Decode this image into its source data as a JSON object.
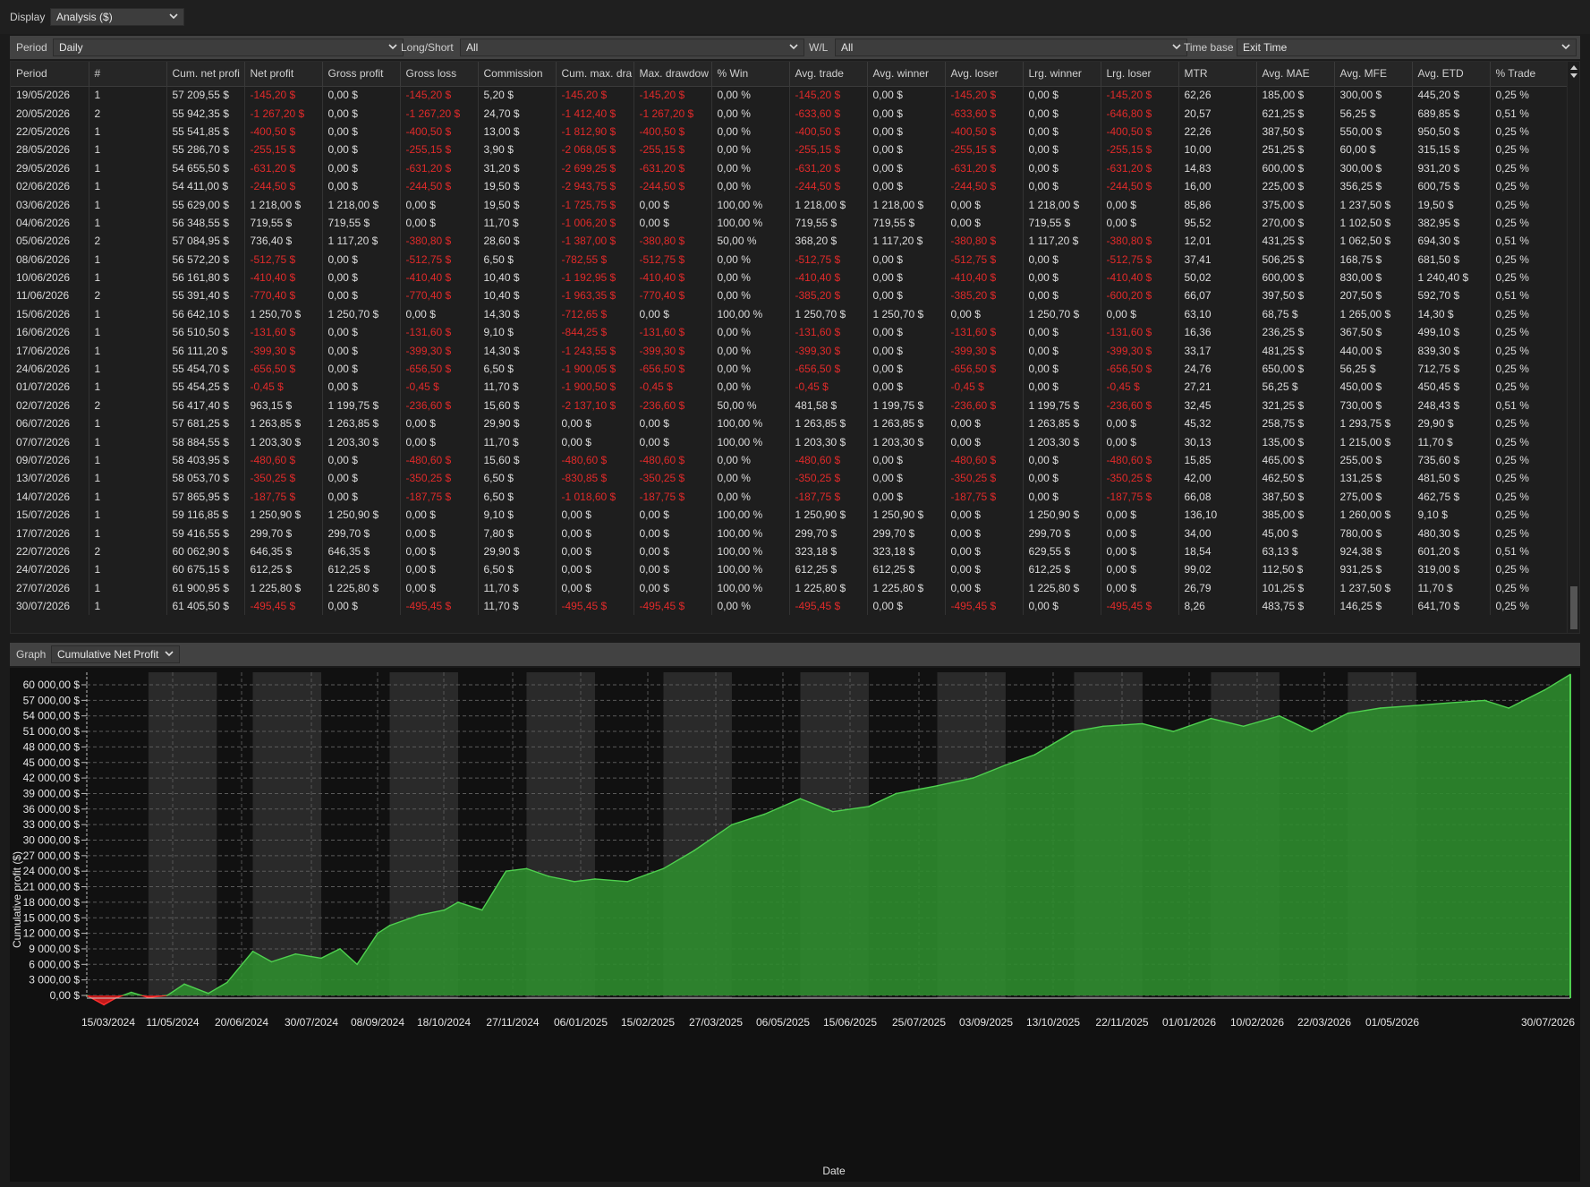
{
  "display": {
    "label": "Display",
    "value": "Analysis ($)"
  },
  "filters": {
    "period_label": "Period",
    "period_value": "Daily",
    "longshort_label": "Long/Short",
    "longshort_value": "All",
    "wl_label": "W/L",
    "wl_value": "All",
    "timebase_label": "Time base",
    "timebase_value": "Exit Time"
  },
  "table": {
    "columns": [
      "Period",
      "#",
      "Cum. net profi",
      "Net profit",
      "Gross profit",
      "Gross loss",
      "Commission",
      "Cum. max. dra",
      "Max. drawdow",
      "% Win",
      "Avg. trade",
      "Avg. winner",
      "Avg. loser",
      "Lrg. winner",
      "Lrg. loser",
      "MTR",
      "Avg. MAE",
      "Avg. MFE",
      "Avg. ETD",
      "% Trade"
    ],
    "rows": [
      [
        "19/05/2026",
        "1",
        "57 209,55 $",
        "-145,20 $",
        "0,00 $",
        "-145,20 $",
        "5,20 $",
        "-145,20 $",
        "-145,20 $",
        "0,00 %",
        "-145,20 $",
        "0,00 $",
        "-145,20 $",
        "0,00 $",
        "-145,20 $",
        "62,26",
        "185,00 $",
        "300,00 $",
        "445,20 $",
        "0,25 %"
      ],
      [
        "20/05/2026",
        "2",
        "55 942,35 $",
        "-1 267,20 $",
        "0,00 $",
        "-1 267,20 $",
        "24,70 $",
        "-1 412,40 $",
        "-1 267,20 $",
        "0,00 %",
        "-633,60 $",
        "0,00 $",
        "-633,60 $",
        "0,00 $",
        "-646,80 $",
        "20,57",
        "621,25 $",
        "56,25 $",
        "689,85 $",
        "0,51 %"
      ],
      [
        "22/05/2026",
        "1",
        "55 541,85 $",
        "-400,50 $",
        "0,00 $",
        "-400,50 $",
        "13,00 $",
        "-1 812,90 $",
        "-400,50 $",
        "0,00 %",
        "-400,50 $",
        "0,00 $",
        "-400,50 $",
        "0,00 $",
        "-400,50 $",
        "22,26",
        "387,50 $",
        "550,00 $",
        "950,50 $",
        "0,25 %"
      ],
      [
        "28/05/2026",
        "1",
        "55 286,70 $",
        "-255,15 $",
        "0,00 $",
        "-255,15 $",
        "3,90 $",
        "-2 068,05 $",
        "-255,15 $",
        "0,00 %",
        "-255,15 $",
        "0,00 $",
        "-255,15 $",
        "0,00 $",
        "-255,15 $",
        "10,00",
        "251,25 $",
        "60,00 $",
        "315,15 $",
        "0,25 %"
      ],
      [
        "29/05/2026",
        "1",
        "54 655,50 $",
        "-631,20 $",
        "0,00 $",
        "-631,20 $",
        "31,20 $",
        "-2 699,25 $",
        "-631,20 $",
        "0,00 %",
        "-631,20 $",
        "0,00 $",
        "-631,20 $",
        "0,00 $",
        "-631,20 $",
        "14,83",
        "600,00 $",
        "300,00 $",
        "931,20 $",
        "0,25 %"
      ],
      [
        "02/06/2026",
        "1",
        "54 411,00 $",
        "-244,50 $",
        "0,00 $",
        "-244,50 $",
        "19,50 $",
        "-2 943,75 $",
        "-244,50 $",
        "0,00 %",
        "-244,50 $",
        "0,00 $",
        "-244,50 $",
        "0,00 $",
        "-244,50 $",
        "16,00",
        "225,00 $",
        "356,25 $",
        "600,75 $",
        "0,25 %"
      ],
      [
        "03/06/2026",
        "1",
        "55 629,00 $",
        "1 218,00 $",
        "1 218,00 $",
        "0,00 $",
        "19,50 $",
        "-1 725,75 $",
        "0,00 $",
        "100,00 %",
        "1 218,00 $",
        "1 218,00 $",
        "0,00 $",
        "1 218,00 $",
        "0,00 $",
        "85,86",
        "375,00 $",
        "1 237,50 $",
        "19,50 $",
        "0,25 %"
      ],
      [
        "04/06/2026",
        "1",
        "56 348,55 $",
        "719,55 $",
        "719,55 $",
        "0,00 $",
        "11,70 $",
        "-1 006,20 $",
        "0,00 $",
        "100,00 %",
        "719,55 $",
        "719,55 $",
        "0,00 $",
        "719,55 $",
        "0,00 $",
        "95,52",
        "270,00 $",
        "1 102,50 $",
        "382,95 $",
        "0,25 %"
      ],
      [
        "05/06/2026",
        "2",
        "57 084,95 $",
        "736,40 $",
        "1 117,20 $",
        "-380,80 $",
        "28,60 $",
        "-1 387,00 $",
        "-380,80 $",
        "50,00 %",
        "368,20 $",
        "1 117,20 $",
        "-380,80 $",
        "1 117,20 $",
        "-380,80 $",
        "12,01",
        "431,25 $",
        "1 062,50 $",
        "694,30 $",
        "0,51 %"
      ],
      [
        "08/06/2026",
        "1",
        "56 572,20 $",
        "-512,75 $",
        "0,00 $",
        "-512,75 $",
        "6,50 $",
        "-782,55 $",
        "-512,75 $",
        "0,00 %",
        "-512,75 $",
        "0,00 $",
        "-512,75 $",
        "0,00 $",
        "-512,75 $",
        "37,41",
        "506,25 $",
        "168,75 $",
        "681,50 $",
        "0,25 %"
      ],
      [
        "10/06/2026",
        "1",
        "56 161,80 $",
        "-410,40 $",
        "0,00 $",
        "-410,40 $",
        "10,40 $",
        "-1 192,95 $",
        "-410,40 $",
        "0,00 %",
        "-410,40 $",
        "0,00 $",
        "-410,40 $",
        "0,00 $",
        "-410,40 $",
        "50,02",
        "600,00 $",
        "830,00 $",
        "1 240,40 $",
        "0,25 %"
      ],
      [
        "11/06/2026",
        "2",
        "55 391,40 $",
        "-770,40 $",
        "0,00 $",
        "-770,40 $",
        "10,40 $",
        "-1 963,35 $",
        "-770,40 $",
        "0,00 %",
        "-385,20 $",
        "0,00 $",
        "-385,20 $",
        "0,00 $",
        "-600,20 $",
        "66,07",
        "397,50 $",
        "207,50 $",
        "592,70 $",
        "0,51 %"
      ],
      [
        "15/06/2026",
        "1",
        "56 642,10 $",
        "1 250,70 $",
        "1 250,70 $",
        "0,00 $",
        "14,30 $",
        "-712,65 $",
        "0,00 $",
        "100,00 %",
        "1 250,70 $",
        "1 250,70 $",
        "0,00 $",
        "1 250,70 $",
        "0,00 $",
        "63,10",
        "68,75 $",
        "1 265,00 $",
        "14,30 $",
        "0,25 %"
      ],
      [
        "16/06/2026",
        "1",
        "56 510,50 $",
        "-131,60 $",
        "0,00 $",
        "-131,60 $",
        "9,10 $",
        "-844,25 $",
        "-131,60 $",
        "0,00 %",
        "-131,60 $",
        "0,00 $",
        "-131,60 $",
        "0,00 $",
        "-131,60 $",
        "16,36",
        "236,25 $",
        "367,50 $",
        "499,10 $",
        "0,25 %"
      ],
      [
        "17/06/2026",
        "1",
        "56 111,20 $",
        "-399,30 $",
        "0,00 $",
        "-399,30 $",
        "14,30 $",
        "-1 243,55 $",
        "-399,30 $",
        "0,00 %",
        "-399,30 $",
        "0,00 $",
        "-399,30 $",
        "0,00 $",
        "-399,30 $",
        "33,17",
        "481,25 $",
        "440,00 $",
        "839,30 $",
        "0,25 %"
      ],
      [
        "24/06/2026",
        "1",
        "55 454,70 $",
        "-656,50 $",
        "0,00 $",
        "-656,50 $",
        "6,50 $",
        "-1 900,05 $",
        "-656,50 $",
        "0,00 %",
        "-656,50 $",
        "0,00 $",
        "-656,50 $",
        "0,00 $",
        "-656,50 $",
        "24,76",
        "650,00 $",
        "56,25 $",
        "712,75 $",
        "0,25 %"
      ],
      [
        "01/07/2026",
        "1",
        "55 454,25 $",
        "-0,45 $",
        "0,00 $",
        "-0,45 $",
        "11,70 $",
        "-1 900,50 $",
        "-0,45 $",
        "0,00 %",
        "-0,45 $",
        "0,00 $",
        "-0,45 $",
        "0,00 $",
        "-0,45 $",
        "27,21",
        "56,25 $",
        "450,00 $",
        "450,45 $",
        "0,25 %"
      ],
      [
        "02/07/2026",
        "2",
        "56 417,40 $",
        "963,15 $",
        "1 199,75 $",
        "-236,60 $",
        "15,60 $",
        "-2 137,10 $",
        "-236,60 $",
        "50,00 %",
        "481,58 $",
        "1 199,75 $",
        "-236,60 $",
        "1 199,75 $",
        "-236,60 $",
        "32,45",
        "321,25 $",
        "730,00 $",
        "248,43 $",
        "0,51 %"
      ],
      [
        "06/07/2026",
        "1",
        "57 681,25 $",
        "1 263,85 $",
        "1 263,85 $",
        "0,00 $",
        "29,90 $",
        "0,00 $",
        "0,00 $",
        "100,00 %",
        "1 263,85 $",
        "1 263,85 $",
        "0,00 $",
        "1 263,85 $",
        "0,00 $",
        "45,32",
        "258,75 $",
        "1 293,75 $",
        "29,90 $",
        "0,25 %"
      ],
      [
        "07/07/2026",
        "1",
        "58 884,55 $",
        "1 203,30 $",
        "1 203,30 $",
        "0,00 $",
        "11,70 $",
        "0,00 $",
        "0,00 $",
        "100,00 %",
        "1 203,30 $",
        "1 203,30 $",
        "0,00 $",
        "1 203,30 $",
        "0,00 $",
        "30,13",
        "135,00 $",
        "1 215,00 $",
        "11,70 $",
        "0,25 %"
      ],
      [
        "09/07/2026",
        "1",
        "58 403,95 $",
        "-480,60 $",
        "0,00 $",
        "-480,60 $",
        "15,60 $",
        "-480,60 $",
        "-480,60 $",
        "0,00 %",
        "-480,60 $",
        "0,00 $",
        "-480,60 $",
        "0,00 $",
        "-480,60 $",
        "15,85",
        "465,00 $",
        "255,00 $",
        "735,60 $",
        "0,25 %"
      ],
      [
        "13/07/2026",
        "1",
        "58 053,70 $",
        "-350,25 $",
        "0,00 $",
        "-350,25 $",
        "6,50 $",
        "-830,85 $",
        "-350,25 $",
        "0,00 %",
        "-350,25 $",
        "0,00 $",
        "-350,25 $",
        "0,00 $",
        "-350,25 $",
        "42,00",
        "462,50 $",
        "131,25 $",
        "481,50 $",
        "0,25 %"
      ],
      [
        "14/07/2026",
        "1",
        "57 865,95 $",
        "-187,75 $",
        "0,00 $",
        "-187,75 $",
        "6,50 $",
        "-1 018,60 $",
        "-187,75 $",
        "0,00 %",
        "-187,75 $",
        "0,00 $",
        "-187,75 $",
        "0,00 $",
        "-187,75 $",
        "66,08",
        "387,50 $",
        "275,00 $",
        "462,75 $",
        "0,25 %"
      ],
      [
        "15/07/2026",
        "1",
        "59 116,85 $",
        "1 250,90 $",
        "1 250,90 $",
        "0,00 $",
        "9,10 $",
        "0,00 $",
        "0,00 $",
        "100,00 %",
        "1 250,90 $",
        "1 250,90 $",
        "0,00 $",
        "1 250,90 $",
        "0,00 $",
        "136,10",
        "385,00 $",
        "1 260,00 $",
        "9,10 $",
        "0,25 %"
      ],
      [
        "17/07/2026",
        "1",
        "59 416,55 $",
        "299,70 $",
        "299,70 $",
        "0,00 $",
        "7,80 $",
        "0,00 $",
        "0,00 $",
        "100,00 %",
        "299,70 $",
        "299,70 $",
        "0,00 $",
        "299,70 $",
        "0,00 $",
        "34,00",
        "45,00 $",
        "780,00 $",
        "480,30 $",
        "0,25 %"
      ],
      [
        "22/07/2026",
        "2",
        "60 062,90 $",
        "646,35 $",
        "646,35 $",
        "0,00 $",
        "29,90 $",
        "0,00 $",
        "0,00 $",
        "100,00 %",
        "323,18 $",
        "323,18 $",
        "0,00 $",
        "629,55 $",
        "0,00 $",
        "18,54",
        "63,13 $",
        "924,38 $",
        "601,20 $",
        "0,51 %"
      ],
      [
        "24/07/2026",
        "1",
        "60 675,15 $",
        "612,25 $",
        "612,25 $",
        "0,00 $",
        "6,50 $",
        "0,00 $",
        "0,00 $",
        "100,00 %",
        "612,25 $",
        "612,25 $",
        "0,00 $",
        "612,25 $",
        "0,00 $",
        "99,02",
        "112,50 $",
        "931,25 $",
        "319,00 $",
        "0,25 %"
      ],
      [
        "27/07/2026",
        "1",
        "61 900,95 $",
        "1 225,80 $",
        "1 225,80 $",
        "0,00 $",
        "11,70 $",
        "0,00 $",
        "0,00 $",
        "100,00 %",
        "1 225,80 $",
        "1 225,80 $",
        "0,00 $",
        "1 225,80 $",
        "0,00 $",
        "26,79",
        "101,25 $",
        "1 237,50 $",
        "11,70 $",
        "0,25 %"
      ],
      [
        "30/07/2026",
        "1",
        "61 405,50 $",
        "-495,45 $",
        "0,00 $",
        "-495,45 $",
        "11,70 $",
        "-495,45 $",
        "-495,45 $",
        "0,00 %",
        "-495,45 $",
        "0,00 $",
        "-495,45 $",
        "0,00 $",
        "-495,45 $",
        "8,26",
        "483,75 $",
        "146,25 $",
        "641,70 $",
        "0,25 %"
      ]
    ]
  },
  "graph": {
    "label": "Graph",
    "value": "Cumulative Net Profit"
  },
  "chart_data": {
    "type": "area",
    "title": "",
    "xlabel": "Date",
    "ylabel": "Cumulative profit ($)",
    "ylim": [
      -2000,
      63000
    ],
    "y_ticks": [
      "0,00 $",
      "3 000,00 $",
      "6 000,00 $",
      "9 000,00 $",
      "12 000,00 $",
      "15 000,00 $",
      "18 000,00 $",
      "21 000,00 $",
      "24 000,00 $",
      "27 000,00 $",
      "30 000,00 $",
      "33 000,00 $",
      "36 000,00 $",
      "39 000,00 $",
      "42 000,00 $",
      "45 000,00 $",
      "48 000,00 $",
      "51 000,00 $",
      "54 000,00 $",
      "57 000,00 $",
      "60 000,00 $"
    ],
    "x_ticks": [
      "15/03/2024",
      "11/05/2024",
      "20/06/2024",
      "30/07/2024",
      "08/09/2024",
      "18/10/2024",
      "27/11/2024",
      "06/01/2025",
      "15/02/2025",
      "27/03/2025",
      "06/05/2025",
      "15/06/2025",
      "25/07/2025",
      "03/09/2025",
      "13/10/2025",
      "22/11/2025",
      "01/01/2026",
      "10/02/2026",
      "22/03/2026",
      "01/05/2026",
      "30/07/2026"
    ],
    "x": [
      "2024-03-15",
      "2024-03-25",
      "2024-04-01",
      "2024-04-10",
      "2024-04-20",
      "2024-05-01",
      "2024-05-11",
      "2024-05-25",
      "2024-06-05",
      "2024-06-20",
      "2024-07-01",
      "2024-07-15",
      "2024-07-30",
      "2024-08-10",
      "2024-08-20",
      "2024-09-01",
      "2024-09-08",
      "2024-09-25",
      "2024-10-10",
      "2024-10-18",
      "2024-11-01",
      "2024-11-15",
      "2024-11-27",
      "2024-12-10",
      "2024-12-25",
      "2025-01-06",
      "2025-01-25",
      "2025-02-15",
      "2025-03-05",
      "2025-03-27",
      "2025-04-15",
      "2025-05-06",
      "2025-05-25",
      "2025-06-15",
      "2025-07-01",
      "2025-07-25",
      "2025-08-15",
      "2025-09-03",
      "2025-09-20",
      "2025-10-13",
      "2025-10-30",
      "2025-11-22",
      "2025-12-10",
      "2026-01-01",
      "2026-01-20",
      "2026-02-10",
      "2026-03-01",
      "2026-03-22",
      "2026-04-10",
      "2026-05-01",
      "2026-05-20",
      "2026-06-10",
      "2026-06-24",
      "2026-07-15",
      "2026-07-30"
    ],
    "values": [
      0,
      -1800,
      -500,
      600,
      -400,
      0,
      2200,
      400,
      2500,
      8500,
      6500,
      8000,
      7200,
      9000,
      6000,
      12000,
      13500,
      15500,
      16500,
      18000,
      16500,
      24000,
      24500,
      23000,
      22000,
      22500,
      22000,
      24500,
      28000,
      33000,
      35000,
      38000,
      35500,
      36500,
      39000,
      40500,
      42000,
      44500,
      46500,
      51000,
      52000,
      52500,
      51000,
      53500,
      52000,
      54000,
      51000,
      54500,
      55500,
      56000,
      56500,
      57000,
      55500,
      59000,
      62000
    ],
    "shaded_bands": [
      "2024-04-20/2024-05-30",
      "2024-06-20/2024-07-30",
      "2024-09-08/2024-10-18",
      "2024-11-27/2025-01-06",
      "2025-02-15/2025-03-27",
      "2025-05-06/2025-06-15",
      "2025-07-25/2025-09-03",
      "2025-10-13/2025-11-22",
      "2026-01-01/2026-02-10",
      "2026-03-22/2026-05-01"
    ],
    "grid": true,
    "legend": "none",
    "colors": {
      "positive_fill": "#2e8b2e",
      "positive_line": "#4fd04f",
      "negative_fill": "#c41a1a",
      "background": "#111111",
      "band": "#2a2a2a"
    }
  }
}
